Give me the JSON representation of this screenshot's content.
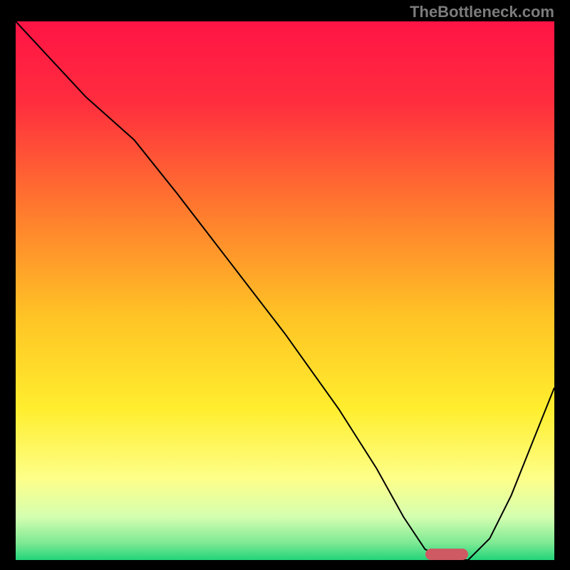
{
  "watermark": "TheBottleneck.com",
  "chart_data": {
    "type": "line",
    "title": "",
    "xlabel": "",
    "ylabel": "",
    "xlim": [
      0,
      100
    ],
    "ylim": [
      0,
      100
    ],
    "x": [
      0,
      13,
      22,
      30,
      40,
      50,
      60,
      67,
      72,
      76,
      80,
      84,
      88,
      92,
      96,
      100
    ],
    "values": [
      100,
      86,
      78,
      68,
      55,
      42,
      28,
      17,
      8,
      2,
      0,
      0,
      4,
      12,
      22,
      32
    ],
    "optimal_marker": {
      "x_start": 76,
      "x_end": 84,
      "y": 0
    },
    "gradient_stops": [
      {
        "pos": 0.0,
        "color": "#ff1445"
      },
      {
        "pos": 0.15,
        "color": "#ff2d3e"
      },
      {
        "pos": 0.35,
        "color": "#ff7a2e"
      },
      {
        "pos": 0.55,
        "color": "#ffc425"
      },
      {
        "pos": 0.72,
        "color": "#ffee2e"
      },
      {
        "pos": 0.85,
        "color": "#fdff8a"
      },
      {
        "pos": 0.92,
        "color": "#d4ffb0"
      },
      {
        "pos": 0.97,
        "color": "#7be893"
      },
      {
        "pos": 1.0,
        "color": "#21d47a"
      }
    ]
  }
}
